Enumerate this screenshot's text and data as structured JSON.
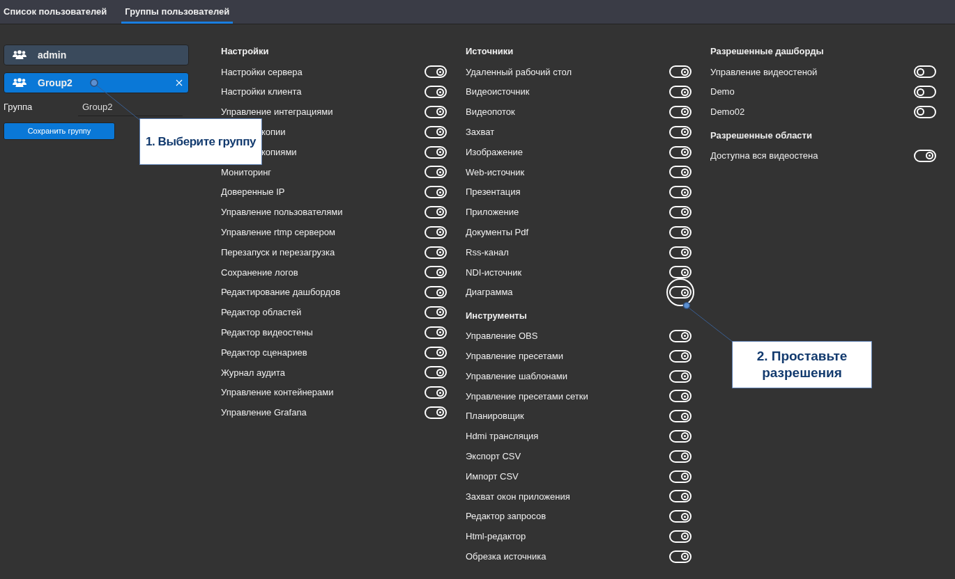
{
  "tabs": [
    {
      "label": "Список пользователей",
      "selected": false
    },
    {
      "label": "Группы пользователей",
      "selected": true
    }
  ],
  "groups": [
    {
      "name": "admin",
      "selected": false
    },
    {
      "name": "Group2",
      "selected": true
    }
  ],
  "group_field": {
    "label": "Группа",
    "value": "Group2"
  },
  "save_button": "Сохранить группу",
  "columns": [
    {
      "sections": [
        {
          "title": "Настройки",
          "items": [
            {
              "label": "Настройки сервера",
              "on": true
            },
            {
              "label": "Настройки клиента",
              "on": true
            },
            {
              "label": "Управление интеграциями",
              "on": true
            },
            {
              "label": "копии",
              "on": true,
              "covered": true
            },
            {
              "label": "копиями",
              "on": true,
              "covered": true
            },
            {
              "label": "Мониторинг",
              "on": true
            },
            {
              "label": "Доверенные IP",
              "on": true
            },
            {
              "label": "Управление пользователями",
              "on": true
            },
            {
              "label": "Управление rtmp сервером",
              "on": true
            },
            {
              "label": "Перезапуск и перезагрузка",
              "on": true
            },
            {
              "label": "Сохранение логов",
              "on": true
            },
            {
              "label": "Редактирование дашбордов",
              "on": true
            },
            {
              "label": "Редактор областей",
              "on": true
            },
            {
              "label": "Редактор видеостены",
              "on": true
            },
            {
              "label": "Редактор сценариев",
              "on": true
            },
            {
              "label": "Журнал аудита",
              "on": true
            },
            {
              "label": "Управление контейнерами",
              "on": true
            },
            {
              "label": "Управление Grafana",
              "on": true
            }
          ]
        }
      ]
    },
    {
      "sections": [
        {
          "title": "Источники",
          "items": [
            {
              "label": "Удаленный рабочий стол",
              "on": true
            },
            {
              "label": "Видеоисточник",
              "on": true
            },
            {
              "label": "Видеопоток",
              "on": true
            },
            {
              "label": "Захват",
              "on": true
            },
            {
              "label": "Изображение",
              "on": true
            },
            {
              "label": "Web-источник",
              "on": true
            },
            {
              "label": "Презентация",
              "on": true
            },
            {
              "label": "Приложение",
              "on": true
            },
            {
              "label": "Документы Pdf",
              "on": true
            },
            {
              "label": "Rss-канал",
              "on": true
            },
            {
              "label": "NDI-источник",
              "on": true
            },
            {
              "label": "Диаграмма",
              "on": true,
              "highlighted": true
            }
          ]
        },
        {
          "title": "Инструменты",
          "items": [
            {
              "label": "Управление OBS",
              "on": true
            },
            {
              "label": "Управление пресетами",
              "on": true
            },
            {
              "label": "Управление шаблонами",
              "on": true
            },
            {
              "label": "Управление пресетами сетки",
              "on": true
            },
            {
              "label": "Планировщик",
              "on": true
            },
            {
              "label": "Hdmi трансляция",
              "on": true
            },
            {
              "label": "Экспорт CSV",
              "on": true
            },
            {
              "label": "Импорт CSV",
              "on": true
            },
            {
              "label": "Захват окон приложения",
              "on": true
            },
            {
              "label": "Редактор запросов",
              "on": true
            },
            {
              "label": "Html-редактор",
              "on": true
            },
            {
              "label": "Обрезка источника",
              "on": true
            }
          ]
        }
      ]
    },
    {
      "sections": [
        {
          "title": "Разрешенные дашборды",
          "items": [
            {
              "label": "Управление видеостеной",
              "on": false
            },
            {
              "label": "Demo",
              "on": false
            },
            {
              "label": "Demo02",
              "on": false
            }
          ]
        },
        {
          "title": "Разрешенные области",
          "items": [
            {
              "label": "Доступна вся видеостена",
              "on": true
            }
          ]
        }
      ]
    }
  ],
  "callouts": [
    {
      "text": "1. Выберите группу"
    },
    {
      "text": "2. Проставьте разрешения"
    }
  ]
}
